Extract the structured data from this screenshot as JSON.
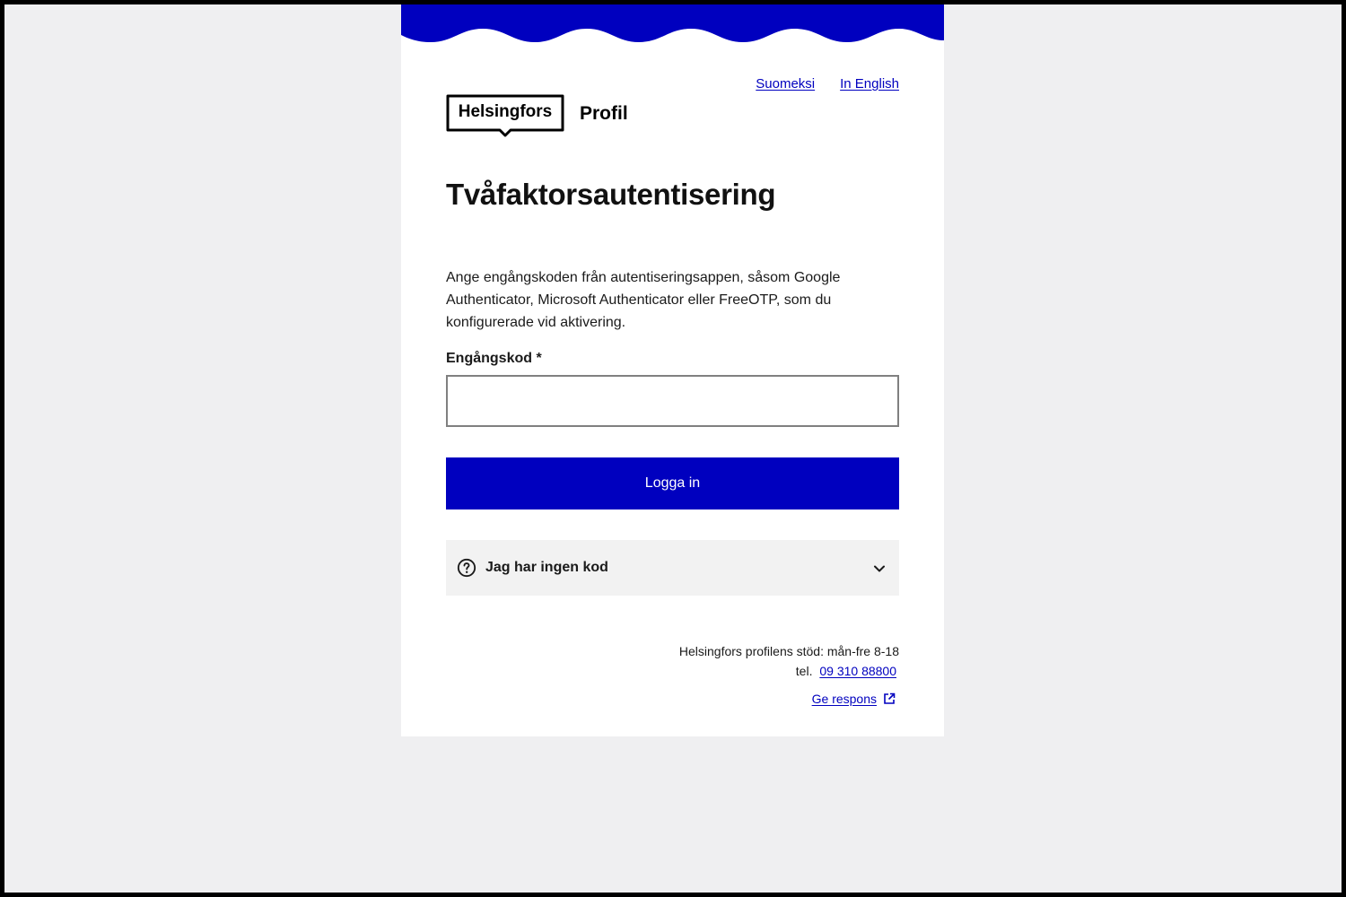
{
  "header": {
    "languages": [
      "Suomeksi",
      "In English"
    ],
    "logo_text": "Helsingfors",
    "app_name": "Profil"
  },
  "main": {
    "title": "Tvåfaktorsautentisering",
    "instructions": "Ange engångskoden från autentiseringsappen, såsom Google Authenticator, Microsoft Authenticator eller FreeOTP, som du konfigurerade vid aktivering.",
    "code_field": {
      "label": "Engångskod *",
      "value": "",
      "placeholder": ""
    },
    "login_button": "Logga in",
    "no_code_accordion": {
      "label": "Jag har ingen kod",
      "icon": "question-circle-icon",
      "expand_icon": "chevron-down-icon"
    }
  },
  "footer": {
    "support_text": "Helsingfors profilens stöd: mån-fre 8-18",
    "phone_prefix": "tel.",
    "phone": "09 310 88800",
    "feedback_link": "Ge respons",
    "feedback_icon": "external-link-icon"
  },
  "colors": {
    "brand_blue": "#0000bf",
    "page_background": "#efeff1",
    "card_background": "#ffffff",
    "accordion_background": "#f2f2f2",
    "input_border": "#808080"
  }
}
